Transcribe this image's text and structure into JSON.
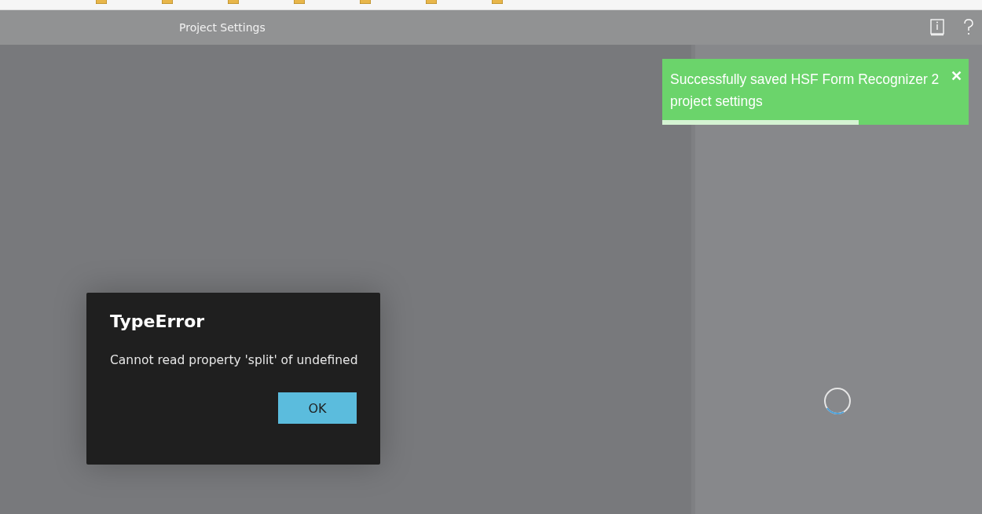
{
  "title_bar": {
    "title": "Project Settings"
  },
  "toast": {
    "message": "Successfully saved HSF Form Recognizer 2 project settings",
    "close": "✕",
    "level": 0.64
  },
  "dialog": {
    "title": "TypeError",
    "message": "Cannot read property 'split' of undefined",
    "button": "OK"
  }
}
